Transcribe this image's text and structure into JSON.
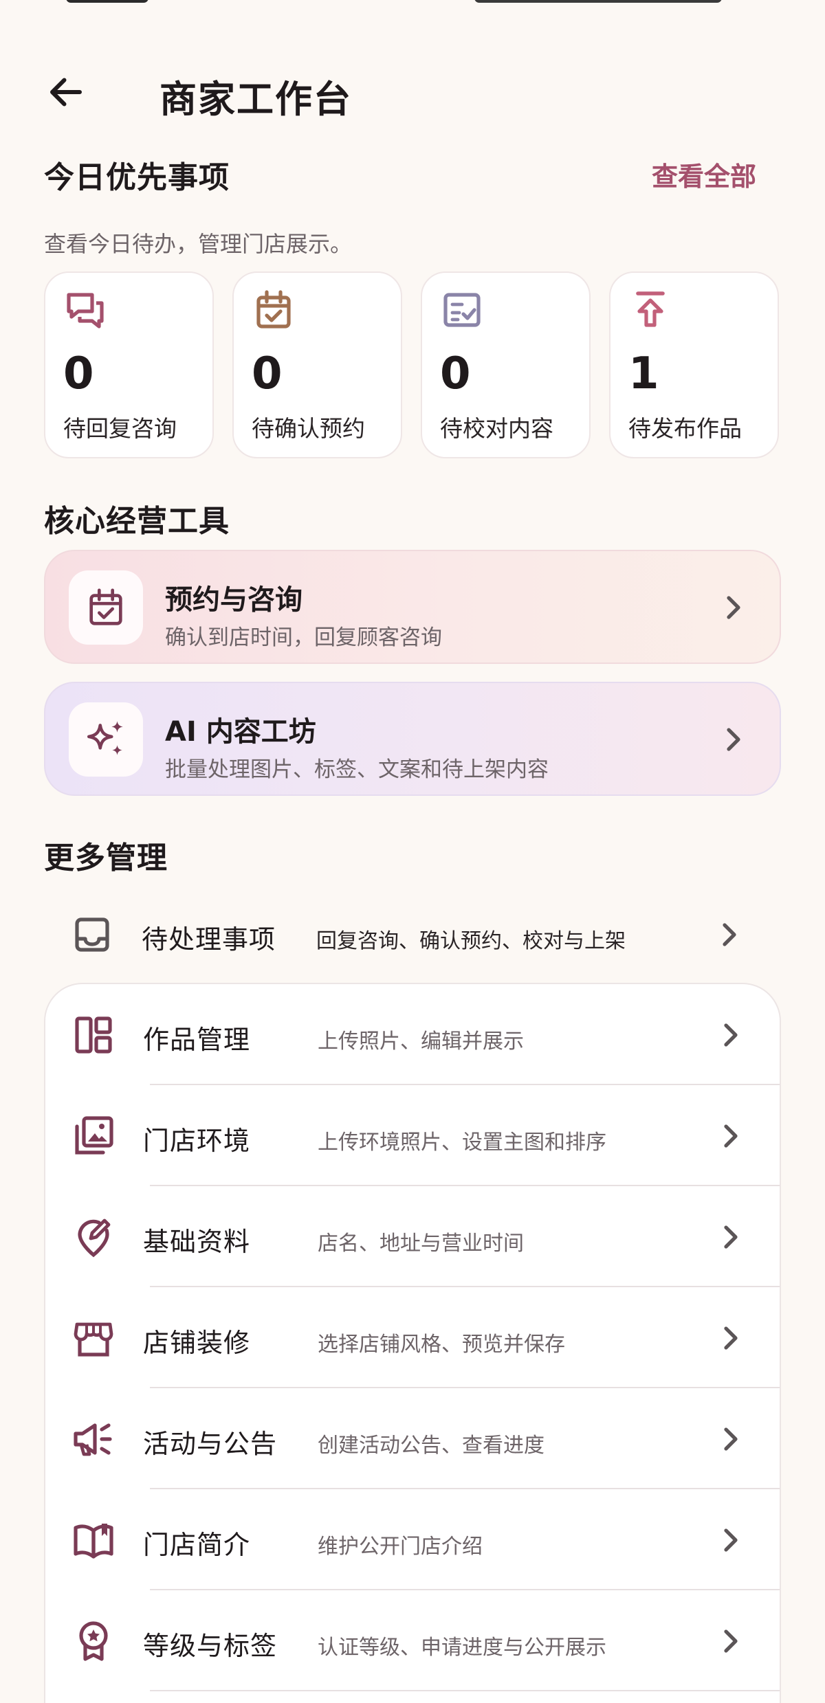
{
  "header": {
    "title": "商家工作台"
  },
  "priority": {
    "title": "今日优先事项",
    "view_all": "查看全部",
    "subtitle": "查看今日待办，管理门店展示。",
    "stats": [
      {
        "value": "0",
        "label": "待回复咨询",
        "icon": "chat-bubbles-icon",
        "color": "#a4506c"
      },
      {
        "value": "0",
        "label": "待确认预约",
        "icon": "calendar-check-icon",
        "color": "#a07050"
      },
      {
        "value": "0",
        "label": "待校对内容",
        "icon": "checklist-icon",
        "color": "#8a84a8"
      },
      {
        "value": "1",
        "label": "待发布作品",
        "icon": "publish-upload-icon",
        "color": "#c2607a"
      }
    ]
  },
  "core_tools": {
    "title": "核心经营工具",
    "items": [
      {
        "title": "预约与咨询",
        "desc": "确认到店时间，回复顾客咨询",
        "icon": "calendar-check-icon"
      },
      {
        "title": "AI 内容工坊",
        "desc": "批量处理图片、标签、文案和待上架内容",
        "icon": "sparkles-icon"
      }
    ]
  },
  "more": {
    "title": "更多管理",
    "pending": {
      "title": "待处理事项",
      "desc": "回复咨询、确认预约、校对与上架",
      "icon": "inbox-tray-icon"
    },
    "items": [
      {
        "title": "作品管理",
        "desc": "上传照片、编辑并展示",
        "icon": "dashboard-layout-icon"
      },
      {
        "title": "门店环境",
        "desc": "上传环境照片、设置主图和排序",
        "icon": "photo-library-icon"
      },
      {
        "title": "基础资料",
        "desc": "店名、地址与营业时间",
        "icon": "location-edit-icon"
      },
      {
        "title": "店铺装修",
        "desc": "选择店铺风格、预览并保存",
        "icon": "storefront-icon"
      },
      {
        "title": "活动与公告",
        "desc": "创建活动公告、查看进度",
        "icon": "megaphone-icon"
      },
      {
        "title": "门店简介",
        "desc": "维护公开门店介绍",
        "icon": "open-book-icon"
      },
      {
        "title": "等级与标签",
        "desc": "认证等级、申请进度与公开展示",
        "icon": "award-badge-icon"
      }
    ]
  },
  "colors": {
    "accent": "#a4506c",
    "icon_mauve": "#7a3b55",
    "icon_gray": "#5b5557",
    "background": "#fcf8f4"
  }
}
